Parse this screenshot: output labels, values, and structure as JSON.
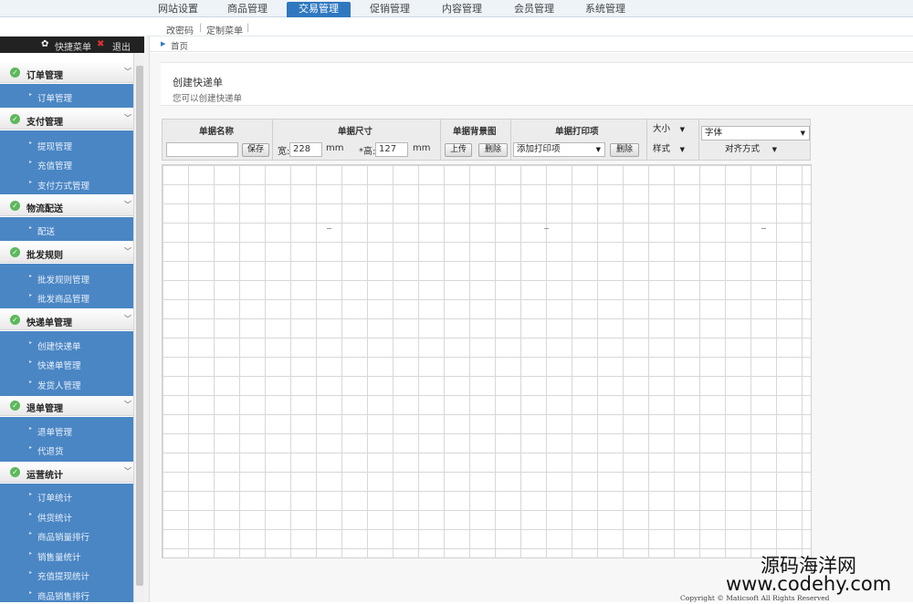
{
  "top_tabs": [
    "网站设置",
    "商品管理",
    "交易管理",
    "促销管理",
    "内容管理",
    "会员管理",
    "系统管理"
  ],
  "active_tab": "交易管理",
  "sub_links": [
    "改密码",
    "|",
    "定制菜单",
    "|"
  ],
  "sidebar": {
    "quick_menu": "快捷菜单",
    "logout": "退出",
    "groups": [
      {
        "title": "订单管理",
        "items": [
          "订单管理"
        ]
      },
      {
        "title": "支付管理",
        "items": [
          "提现管理",
          "充值管理",
          "支付方式管理"
        ]
      },
      {
        "title": "物流配送",
        "items": [
          "配送"
        ]
      },
      {
        "title": "批发规则",
        "items": [
          "批发规则管理",
          "批发商品管理"
        ]
      },
      {
        "title": "快递单管理",
        "items": [
          "创建快递单",
          "快递单管理",
          "发货人管理"
        ]
      },
      {
        "title": "退单管理",
        "items": [
          "退单管理",
          "代退货"
        ]
      },
      {
        "title": "运营统计",
        "items": [
          "订单统计",
          "供货统计",
          "商品销量排行",
          "销售量统计",
          "充值提现统计",
          "商品销售排行"
        ]
      }
    ]
  },
  "breadcrumb": "首页",
  "header": {
    "title": "创建快递单",
    "desc": "您可以创建快递单"
  },
  "toolbar": {
    "name_header": "单据名称",
    "save": "保存",
    "size_header": "单据尺寸",
    "width_label": "宽:",
    "width_value": "228",
    "height_label": "*高:",
    "height_value": "127",
    "unit": "mm",
    "bg_header": "单据背景图",
    "upload": "上传",
    "delete": "删除",
    "print_header": "单据打印项",
    "print_select": "添加打印项",
    "size_select": "大小",
    "style_select": "样式",
    "font_select": "字体",
    "align_select": "对齐方式"
  },
  "footer": "Copyright © Maticsoft All Rights Reserved",
  "watermark": {
    "line1": "源码海洋网",
    "line2": "www.codehy.com"
  },
  "colors": {
    "accent": "#2f78c0",
    "sidebar_item_bg": "#4a86c4",
    "check": "#5cb85c"
  }
}
